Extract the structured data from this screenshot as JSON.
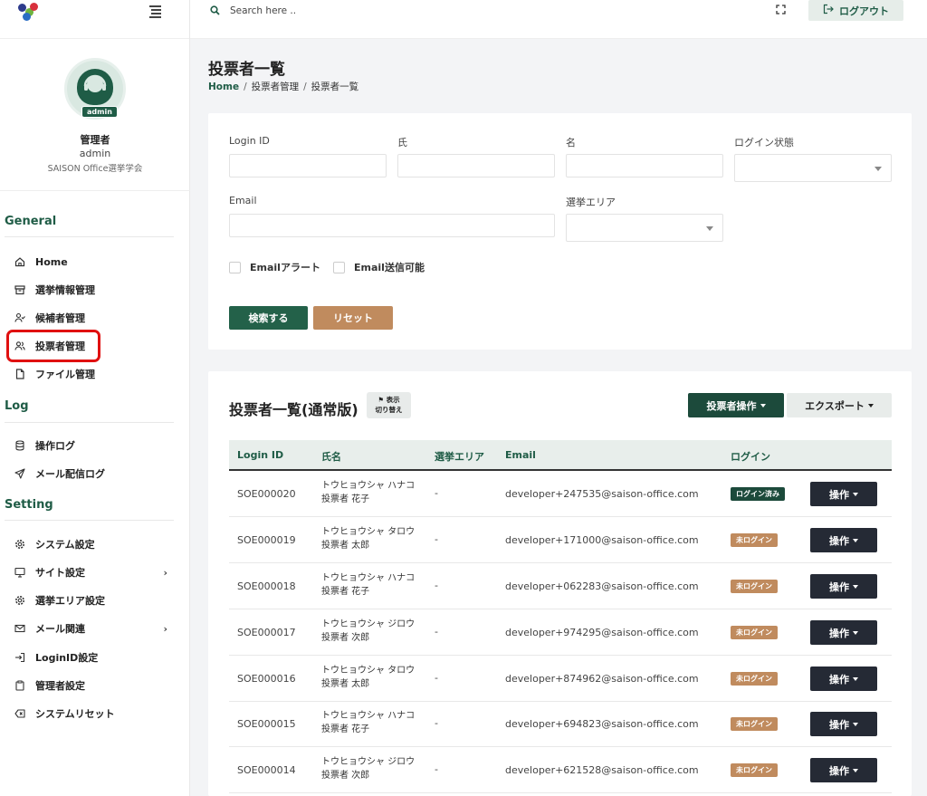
{
  "sidebar": {
    "profile": {
      "badge": "admin",
      "name": "管理者",
      "user_id": "admin",
      "org": "SAISON Office選挙学会"
    },
    "sections": {
      "general": "General",
      "log": "Log",
      "setting": "Setting"
    },
    "items": {
      "home": "Home",
      "election": "選挙情報管理",
      "candidates": "候補者管理",
      "voters": "投票者管理",
      "files": "ファイル管理",
      "oplog": "操作ログ",
      "maillog": "メール配信ログ",
      "system": "システム設定",
      "site": "サイト設定",
      "area": "選挙エリア設定",
      "mail": "メール関連",
      "loginid": "LoginID設定",
      "admin": "管理者設定",
      "reset": "システムリセット"
    }
  },
  "topbar": {
    "search_placeholder": "Search here ..",
    "logout_label": "ログアウト"
  },
  "page": {
    "title": "投票者一覧",
    "breadcrumb": [
      "Home",
      "投票者管理",
      "投票者一覧"
    ]
  },
  "filter": {
    "login_id": "Login ID",
    "last_name": "氏",
    "first_name": "名",
    "login_state": "ログイン状態",
    "email": "Email",
    "area": "選挙エリア",
    "chk_alert": "Emailアラート",
    "chk_sendable": "Email送信可能",
    "search_btn": "検索する",
    "reset_btn": "リセット"
  },
  "list": {
    "title": "投票者一覧(通常版)",
    "toggle_line1": "表示",
    "toggle_line2": "切り替え",
    "ops_btn": "投票者操作",
    "export_btn": "エクスポート",
    "columns": [
      "Login ID",
      "氏名",
      "選挙エリア",
      "Email",
      "ログイン"
    ],
    "row_action": "操作",
    "rows": [
      {
        "id": "SOE000020",
        "kana": "トウヒョウシャ ハナコ",
        "name": "投票者 花子",
        "area": "-",
        "email": "developer+247535@saison-office.com",
        "status": "ログイン済み",
        "state": "done"
      },
      {
        "id": "SOE000019",
        "kana": "トウヒョウシャ タロウ",
        "name": "投票者 太郎",
        "area": "-",
        "email": "developer+171000@saison-office.com",
        "status": "未ログイン",
        "state": "not"
      },
      {
        "id": "SOE000018",
        "kana": "トウヒョウシャ ハナコ",
        "name": "投票者 花子",
        "area": "-",
        "email": "developer+062283@saison-office.com",
        "status": "未ログイン",
        "state": "not"
      },
      {
        "id": "SOE000017",
        "kana": "トウヒョウシャ ジロウ",
        "name": "投票者 次郎",
        "area": "-",
        "email": "developer+974295@saison-office.com",
        "status": "未ログイン",
        "state": "not"
      },
      {
        "id": "SOE000016",
        "kana": "トウヒョウシャ タロウ",
        "name": "投票者 太郎",
        "area": "-",
        "email": "developer+874962@saison-office.com",
        "status": "未ログイン",
        "state": "not"
      },
      {
        "id": "SOE000015",
        "kana": "トウヒョウシャ ハナコ",
        "name": "投票者 花子",
        "area": "-",
        "email": "developer+694823@saison-office.com",
        "status": "未ログイン",
        "state": "not"
      },
      {
        "id": "SOE000014",
        "kana": "トウヒョウシャ ジロウ",
        "name": "投票者 次郎",
        "area": "-",
        "email": "developer+621528@saison-office.com",
        "status": "未ログイン",
        "state": "not"
      }
    ]
  },
  "colors": {
    "primary": "#1f5c46",
    "accent": "#c08b5e",
    "dark": "#252a35",
    "highlight": "#e01010"
  },
  "icons": {
    "search": "search-icon",
    "menu": "hamburger-icon",
    "fullscreen": "fullscreen-icon",
    "logout": "logout-icon"
  }
}
